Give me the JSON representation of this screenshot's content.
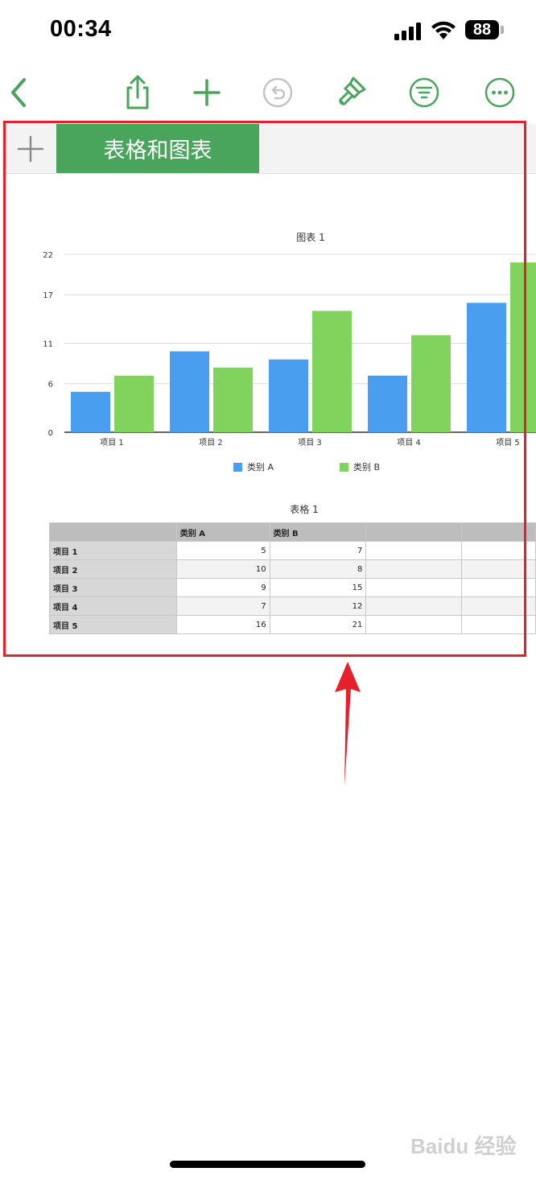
{
  "status_bar": {
    "time": "00:34",
    "battery": "88"
  },
  "toolbar": {
    "back": "back-icon",
    "share": "share-icon",
    "add": "plus-icon",
    "undo": "undo-icon",
    "format": "paintbrush-icon",
    "filter": "filter-icon",
    "more": "more-icon"
  },
  "sheet_tabs": {
    "active_tab": "表格和图表"
  },
  "colors": {
    "accent": "#4aa55c",
    "series_a": "#4a9ef0",
    "series_b": "#80d45e",
    "highlight": "#e5202a"
  },
  "chart_data": {
    "type": "bar",
    "title": "图表 1",
    "categories": [
      "项目 1",
      "项目 2",
      "项目 3",
      "项目 4",
      "项目 5"
    ],
    "series": [
      {
        "name": "类别 A",
        "values": [
          5,
          10,
          9,
          7,
          16
        ]
      },
      {
        "name": "类别 B",
        "values": [
          7,
          8,
          15,
          12,
          21
        ]
      }
    ],
    "yticks": [
      "0",
      "6",
      "11",
      "17",
      "22"
    ],
    "ylim": [
      0,
      22
    ],
    "grid": true,
    "legend": "bottom"
  },
  "table": {
    "title": "表格 1",
    "headers": [
      "",
      "类别 A",
      "类别 B",
      "",
      ""
    ],
    "rows": [
      {
        "label": "项目 1",
        "a": "5",
        "b": "7"
      },
      {
        "label": "项目 2",
        "a": "10",
        "b": "8"
      },
      {
        "label": "项目 3",
        "a": "9",
        "b": "15"
      },
      {
        "label": "项目 4",
        "a": "7",
        "b": "12"
      },
      {
        "label": "项目 5",
        "a": "16",
        "b": "21"
      }
    ]
  },
  "watermark": "Baidu 经验"
}
